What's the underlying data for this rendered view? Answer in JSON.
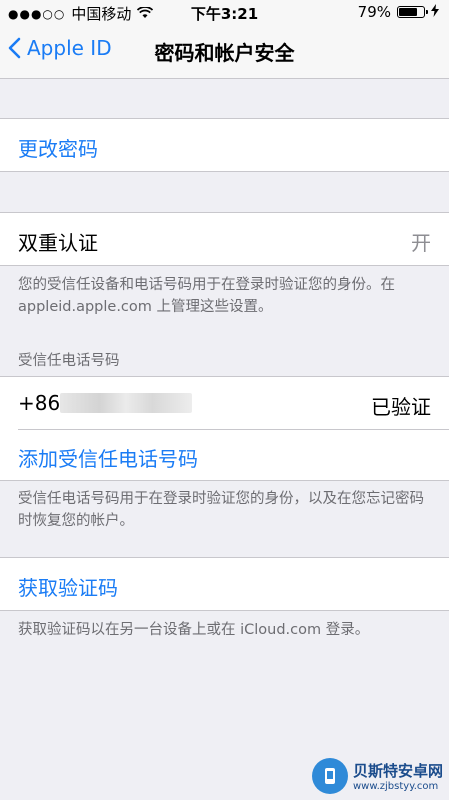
{
  "status_bar": {
    "signal_dots": "●●●○○",
    "carrier": "中国移动",
    "wifi_icon": "wifi-icon",
    "time": "下午3:21",
    "battery_percent": "79%",
    "battery_level": 0.79
  },
  "nav": {
    "back_label": "Apple ID",
    "title": "密码和帐户安全"
  },
  "change_password": {
    "label": "更改密码"
  },
  "two_factor": {
    "label": "双重认证",
    "value": "开",
    "footer": "您的受信任设备和电话号码用于在登录时验证您的身份。在 appleid.apple.com 上管理这些设置。"
  },
  "trusted_phone": {
    "header": "受信任电话号码",
    "number_prefix": "+86",
    "status": "已验证",
    "add_label": "添加受信任电话号码",
    "footer": "受信任电话号码用于在登录时验证您的身份，以及在您忘记密码时恢复您的帐户。"
  },
  "verification": {
    "label": "获取验证码",
    "footer": "获取验证码以在另一台设备上或在 iCloud.com 登录。"
  },
  "watermark": {
    "name": "贝斯特安卓网",
    "url": "www.zjbstyy.com"
  }
}
